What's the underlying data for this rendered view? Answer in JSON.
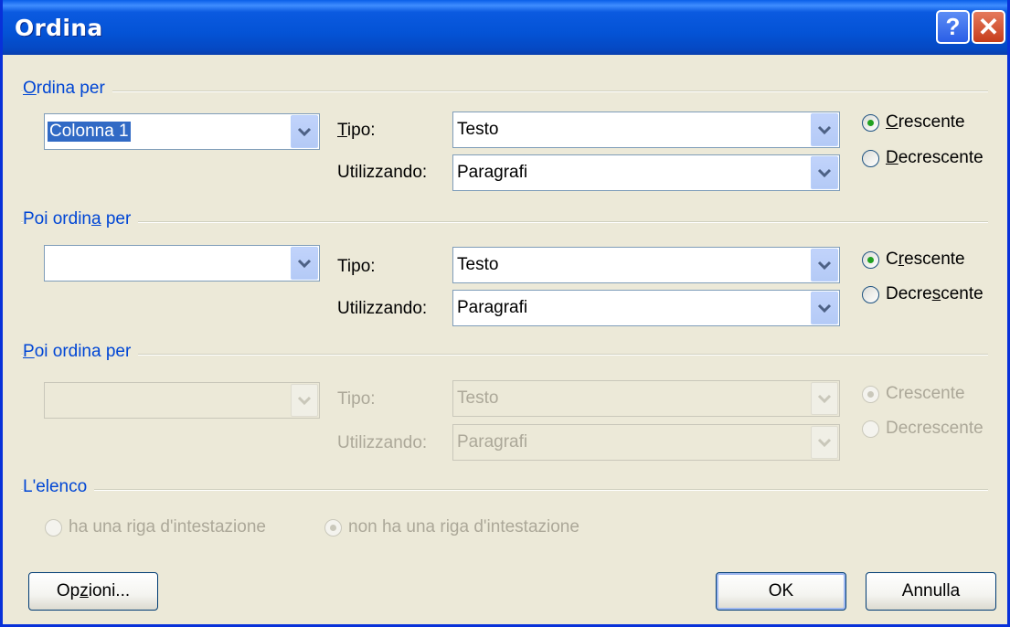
{
  "window": {
    "title": "Ordina"
  },
  "titlebar_buttons": {
    "help": "?",
    "close": "✕"
  },
  "section1": {
    "heading_pre": "",
    "heading_u": "O",
    "heading_post": "rdina per",
    "column_value": "Colonna 1",
    "tipo_pre": "",
    "tipo_u": "T",
    "tipo_post": "ipo:",
    "tipo_value": "Testo",
    "utilizzando_label": "Utilizzando:",
    "utilizzando_value": "Paragrafi",
    "asc_pre": "",
    "asc_u": "C",
    "asc_post": "rescente",
    "desc_pre": "",
    "desc_u": "D",
    "desc_post": "ecrescente"
  },
  "section2": {
    "heading_pre": "Poi ordin",
    "heading_u": "a",
    "heading_post": " per",
    "column_value": "",
    "tipo_label": "Tipo:",
    "tipo_value": "Testo",
    "utilizzando_label": "Utilizzando:",
    "utilizzando_value": "Paragrafi",
    "asc_pre": "C",
    "asc_u": "r",
    "asc_post": "escente",
    "desc_pre": "Decre",
    "desc_u": "s",
    "desc_post": "cente"
  },
  "section3": {
    "heading_pre": "",
    "heading_u": "P",
    "heading_post": "oi ordina per",
    "column_value": "",
    "tipo_label": "Tipo:",
    "tipo_value": "Testo",
    "utilizzando_label": "Utilizzando:",
    "utilizzando_value": "Paragrafi",
    "asc_label": "Crescente",
    "desc_label": "Decrescente"
  },
  "list_section": {
    "heading": "L'elenco",
    "has_header": "ha una riga d'intestazione",
    "no_header": "non ha una riga d'intestazione"
  },
  "buttons": {
    "options_pre": "Op",
    "options_u": "z",
    "options_post": "ioni...",
    "ok": "OK",
    "cancel": "Annulla"
  }
}
